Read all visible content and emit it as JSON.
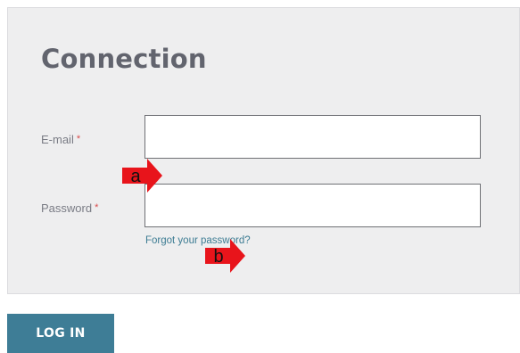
{
  "form": {
    "title": "Connection",
    "email": {
      "label": "E-mail",
      "required_mark": "*",
      "value": "",
      "placeholder": ""
    },
    "password": {
      "label": "Password",
      "required_mark": "*",
      "value": "",
      "placeholder": ""
    },
    "forgot_password_link": "Forgot your password?",
    "login_button": "LOG IN"
  },
  "annotations": {
    "marker_a": "a",
    "marker_b": "b",
    "color": "#e8141b"
  },
  "colors": {
    "panel_background": "#eeeeef",
    "title": "#62646e",
    "link": "#3d7c93",
    "button": "#3e7d96",
    "required": "#d84c4c"
  }
}
